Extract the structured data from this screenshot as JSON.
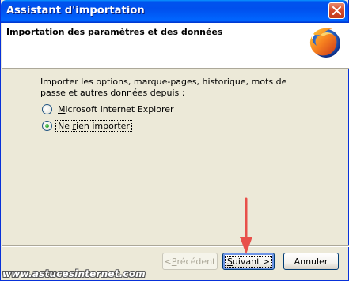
{
  "window": {
    "title": "Assistant d'importation"
  },
  "header": {
    "title": "Importation des paramètres et des données",
    "logo_icon": "firefox-logo-icon"
  },
  "main": {
    "intro": "Importer les options, marque-pages, historique, mots de passe et autres données depuis :",
    "options": [
      {
        "label": "Microsoft Internet Explorer",
        "accel": "M",
        "rest": "icrosoft Internet Explorer",
        "selected": false
      },
      {
        "label": "Ne rien importer",
        "before": "Ne ",
        "accel": "r",
        "rest": "ien importer",
        "selected": true
      }
    ]
  },
  "buttons": {
    "back": {
      "label": "< Précédent",
      "prefix": "< ",
      "accel": "P",
      "rest": "récédent",
      "enabled": false
    },
    "next": {
      "label": "Suivant >",
      "accel": "S",
      "rest": "uivant >",
      "default": true
    },
    "cancel": {
      "label": "Annuler"
    }
  },
  "watermark": "www.astucesinternet.com",
  "colors": {
    "titlebar": "#0054e3",
    "close": "#d4492a",
    "annotation_arrow": "#e8504a",
    "radio_dot": "#21a121"
  }
}
